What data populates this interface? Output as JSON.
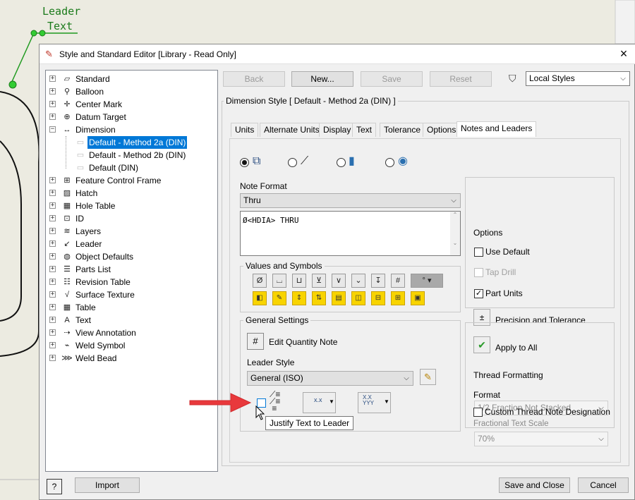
{
  "background": {
    "leader_text": [
      "Leader",
      "Text"
    ]
  },
  "dialog": {
    "title": "Style and Standard Editor [Library - Read Only]",
    "close_label": "×"
  },
  "toolbar": {
    "back": "Back",
    "new": "New...",
    "save": "Save",
    "reset": "Reset",
    "filter_value": "Local Styles"
  },
  "tree": {
    "items": [
      {
        "label": "Standard",
        "icon": "standard-icon"
      },
      {
        "label": "Balloon",
        "icon": "balloon-icon"
      },
      {
        "label": "Center Mark",
        "icon": "center-mark-icon"
      },
      {
        "label": "Datum Target",
        "icon": "datum-target-icon"
      },
      {
        "label": "Dimension",
        "icon": "dimension-icon"
      },
      {
        "label": "Default - Method 2a (DIN)",
        "icon": "style-icon",
        "selected": true
      },
      {
        "label": "Default - Method 2b (DIN)",
        "icon": "style-icon"
      },
      {
        "label": "Default (DIN)",
        "icon": "style-icon"
      },
      {
        "label": "Feature Control Frame",
        "icon": "feature-control-frame-icon"
      },
      {
        "label": "Hatch",
        "icon": "hatch-icon"
      },
      {
        "label": "Hole Table",
        "icon": "hole-table-icon"
      },
      {
        "label": "ID",
        "icon": "id-icon"
      },
      {
        "label": "Layers",
        "icon": "layers-icon"
      },
      {
        "label": "Leader",
        "icon": "leader-icon"
      },
      {
        "label": "Object Defaults",
        "icon": "object-defaults-icon"
      },
      {
        "label": "Parts List",
        "icon": "parts-list-icon"
      },
      {
        "label": "Revision Table",
        "icon": "revision-table-icon"
      },
      {
        "label": "Surface Texture",
        "icon": "surface-texture-icon"
      },
      {
        "label": "Table",
        "icon": "table-icon"
      },
      {
        "label": "Text",
        "icon": "text-icon"
      },
      {
        "label": "View Annotation",
        "icon": "view-annotation-icon"
      },
      {
        "label": "Weld Symbol",
        "icon": "weld-symbol-icon"
      },
      {
        "label": "Weld Bead",
        "icon": "weld-bead-icon"
      }
    ]
  },
  "panel": {
    "heading": "Dimension Style [ Default - Method 2a (DIN) ]",
    "tabs": [
      "Units",
      "Alternate Units",
      "Display",
      "Text",
      "Tolerance",
      "Options",
      "Notes and Leaders"
    ],
    "active_tab": "Notes and Leaders",
    "note_format_label": "Note Format",
    "note_format_value": "Thru",
    "note_text": "Ø<HDIA> THRU",
    "values_symbols_label": "Values and Symbols",
    "general_settings_label": "General Settings",
    "edit_quantity_note": "Edit Quantity Note",
    "leader_style_label": "Leader Style",
    "leader_style_value": "General (ISO)",
    "xx_label": "x.x",
    "xxyyy_label": "X.X YYY",
    "tooltip": "Justify Text to Leader",
    "options_label": "Options",
    "use_default": "Use Default",
    "tap_drill": "Tap Drill",
    "part_units": "Part Units",
    "precision_tolerance": "Precision and Tolerance",
    "apply_to_all": "Apply to All",
    "thread_formatting_label": "Thread Formatting",
    "format_label": "Format",
    "format_value": "1/2 Fraction Not Stacked",
    "fractional_scale_label": "Fractional Text Scale",
    "fractional_scale_value": "70%",
    "custom_thread_note": "Custom Thread Note Designation"
  },
  "footer": {
    "help": "?",
    "import": "Import",
    "save_close": "Save and Close",
    "cancel": "Cancel"
  },
  "colors": {
    "accent": "#0078d7",
    "leader_green": "#1a7a1a",
    "arrow_red": "#e8393c"
  }
}
